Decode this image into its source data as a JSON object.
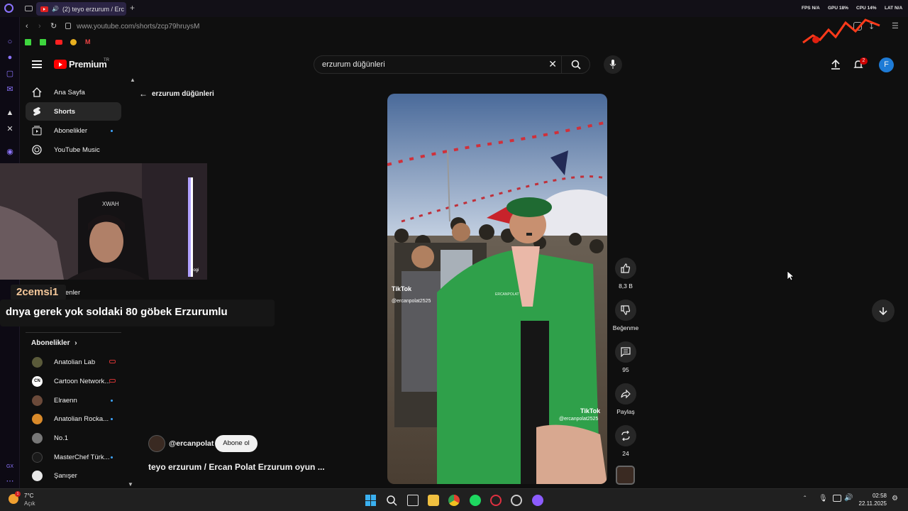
{
  "browser": {
    "tab_title": "(2) teyo erzurum / Erc",
    "url": "www.youtube.com/shorts/zcp79hruysM",
    "hud": {
      "fps": "FPS N/A",
      "gpu": "GPU 18%",
      "cpu": "CPU 14%",
      "lat": "LAT N/A"
    }
  },
  "header": {
    "logo_text": "Premium",
    "region": "TR",
    "search_value": "erzurum düğünleri",
    "notification_count": "2",
    "avatar_letter": "F"
  },
  "sidebar": {
    "items": [
      {
        "label": "Ana Sayfa"
      },
      {
        "label": "Shorts"
      },
      {
        "label": "Abonelikler"
      },
      {
        "label": "YouTube Music"
      }
    ],
    "partial_label": "enler",
    "subscriptions_title": "Abonelikler",
    "subscriptions": [
      {
        "label": "Anatolian Lab",
        "color": "#5a5a3a"
      },
      {
        "label": "Cartoon Network...",
        "color": "#ffffff"
      },
      {
        "label": "Elraenn",
        "color": "#6b4a3a"
      },
      {
        "label": "Anatolian Rocka...",
        "color": "#d98a2a"
      },
      {
        "label": "No.1",
        "color": "#777777"
      },
      {
        "label": "MasterChef Türk...",
        "color": "#1a1a1a"
      },
      {
        "label": "Şanışer",
        "color": "#e8e8e8"
      }
    ]
  },
  "back_link": {
    "label": "erzurum düğünleri"
  },
  "overlay": {
    "username": "2cemsi1",
    "message": "dnya gerek yok soldaki 80 göbek Erzurumlu",
    "webcam_brand": "logi"
  },
  "short": {
    "channel": "@ercanpolat",
    "subscribe_label": "Abone ol",
    "title": "teyo erzurum  / Ercan Polat Erzurum oyun ...",
    "tiktok_brand": "TikTok",
    "tiktok_user": "@ercanpolat2525",
    "jacket_text": "ERCANPOLAT"
  },
  "actions": {
    "like_count": "8,3 B",
    "dislike_label": "Beğenme",
    "comment_count": "95",
    "share_label": "Paylaş",
    "remix_count": "24"
  },
  "taskbar": {
    "weather_temp": "7°C",
    "weather_desc": "Açık",
    "weather_badge": "1",
    "time": "02:58",
    "date": "22.11.2025"
  },
  "colors": {
    "youtube_red": "#ff0000",
    "opera_gx_accent": "#7c5cff",
    "jacket_green": "#2fa04a"
  }
}
